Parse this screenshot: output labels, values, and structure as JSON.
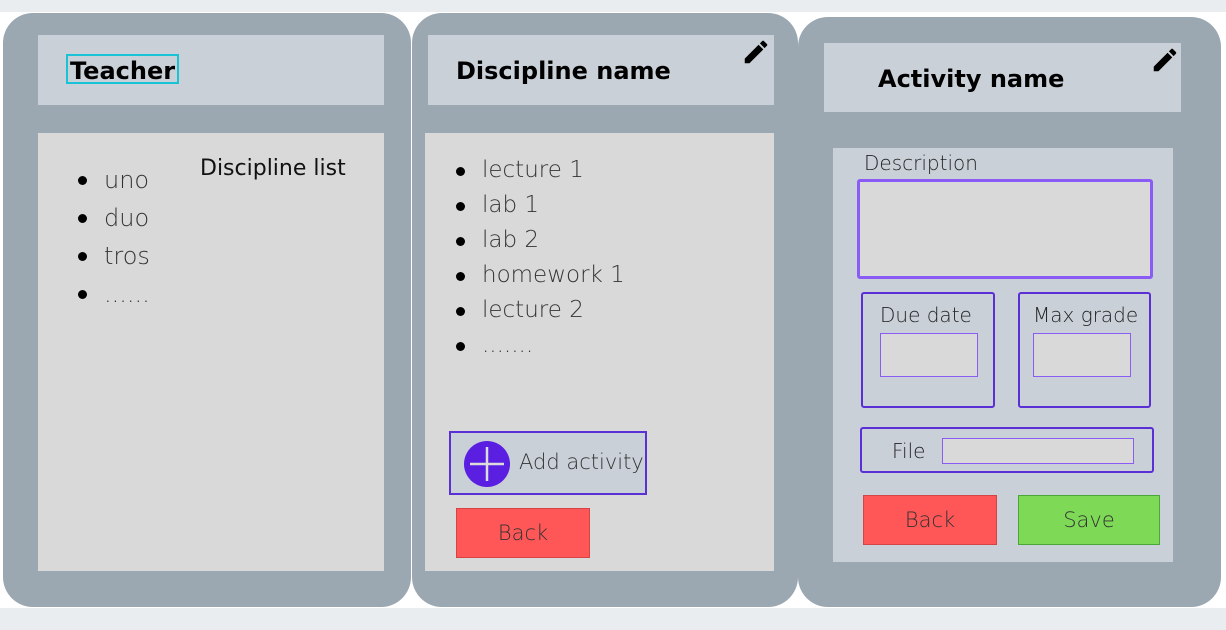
{
  "teacher_panel": {
    "title": "Teacher",
    "list_heading": "Discipline list",
    "items": [
      "uno",
      "duo",
      "tros",
      "......"
    ]
  },
  "discipline_panel": {
    "title": "Discipline name",
    "edit_icon": "pencil-icon",
    "items": [
      "lecture 1",
      "lab 1",
      "lab 2",
      "homework 1",
      "lecture 2",
      "......."
    ],
    "add_activity_label": "Add activity",
    "add_icon": "plus-circle-icon",
    "back_label": "Back"
  },
  "activity_panel": {
    "title": "Activity name",
    "edit_icon": "pencil-icon",
    "description_label": "Description",
    "description_value": "",
    "due_date_label": "Due date",
    "due_date_value": "",
    "max_grade_label": "Max grade",
    "max_grade_value": "",
    "file_label": "File",
    "file_value": "",
    "back_label": "Back",
    "save_label": "Save"
  },
  "colors": {
    "panel": "#9ba7b1",
    "header": "#c9d0d8",
    "content": "#d9d9d9",
    "accent_purple": "#5a2fd6",
    "back_button": "#ff5757",
    "save_button": "#7ed957",
    "selection_outline": "#19c3d6"
  }
}
